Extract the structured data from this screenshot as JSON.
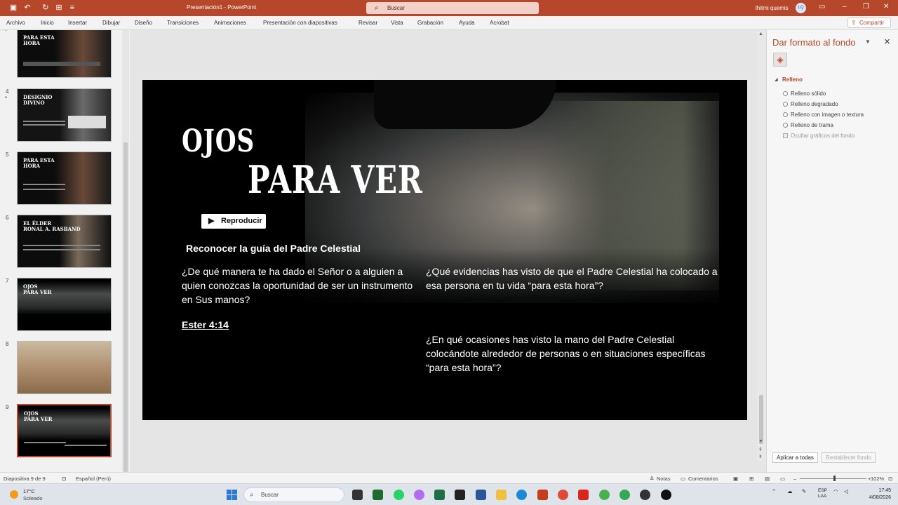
{
  "titlebar": {
    "title": "Presentación1 - PowerPoint",
    "search_placeholder": "Buscar",
    "user_name": "lhitmi quemis",
    "user_initials": "LQ",
    "accent": "#b7472a"
  },
  "ribbon": {
    "tabs": [
      "Archivo",
      "Inicio",
      "Insertar",
      "Dibujar",
      "Diseño",
      "Transiciones",
      "Animaciones",
      "Presentación con diapositivas",
      "Revisar",
      "Vista",
      "Grabación",
      "Ayuda",
      "Acrobat"
    ],
    "share_label": "Compartir"
  },
  "thumbnails": [
    {
      "num": "",
      "title": "PARA ESTA\nHORA",
      "kind": "woman"
    },
    {
      "num": "4",
      "title": "DESIGNIO\nDIVINO",
      "kind": "bird"
    },
    {
      "num": "5",
      "title": "PARA ESTA\nHORA",
      "kind": "woman"
    },
    {
      "num": "6",
      "title": "EL ÉLDER\nRONAL A. RASBAND",
      "kind": "elder"
    },
    {
      "num": "7",
      "title": "OJOS\n   PARA VER",
      "kind": "man"
    },
    {
      "num": "8",
      "title": "",
      "kind": "desert"
    },
    {
      "num": "9",
      "title": "OJOS\n   PARA VER",
      "kind": "man"
    }
  ],
  "slide": {
    "title_line1": "OJOS",
    "title_line2": "PARA VER",
    "play_label": "Reproducir",
    "subtitle": "Reconocer la guía del Padre Celestial",
    "question1": "¿De qué manera te ha dado el Señor o a alguien a quien conozcas la oportunidad de ser un instrumento en Sus manos?",
    "reference": "Ester 4:14",
    "question2": "¿Qué evidencias has visto de que el Padre Celestial ha colocado a esa persona en tu vida “para esta hora”?",
    "question3": "¿En qué ocasiones has visto la mano del Padre Celestial colocándote alrededor de personas o en situaciones específicas “para esta hora”?"
  },
  "format_pane": {
    "title": "Dar formato al fondo",
    "section": "Relleno",
    "options": [
      "Relleno sólido",
      "Relleno degradado",
      "Relleno con imagen o textura",
      "Relleno de trama"
    ],
    "hide_graphics": "Ocultar gráficos del fondo",
    "apply_all": "Aplicar a todas",
    "reset": "Restablecer fondo"
  },
  "statusbar": {
    "slide_info": "Diapositiva 9 de 9",
    "language": "Español (Perú)",
    "notes": "Notas",
    "comments": "Comentarios",
    "zoom": "102%"
  },
  "taskbar": {
    "temperature": "17°C",
    "weather": "Soleado",
    "search_placeholder": "Buscar",
    "lang_top": "ESP",
    "lang_bottom": "LAA",
    "time": "17:45",
    "date": "4/08/2026"
  }
}
